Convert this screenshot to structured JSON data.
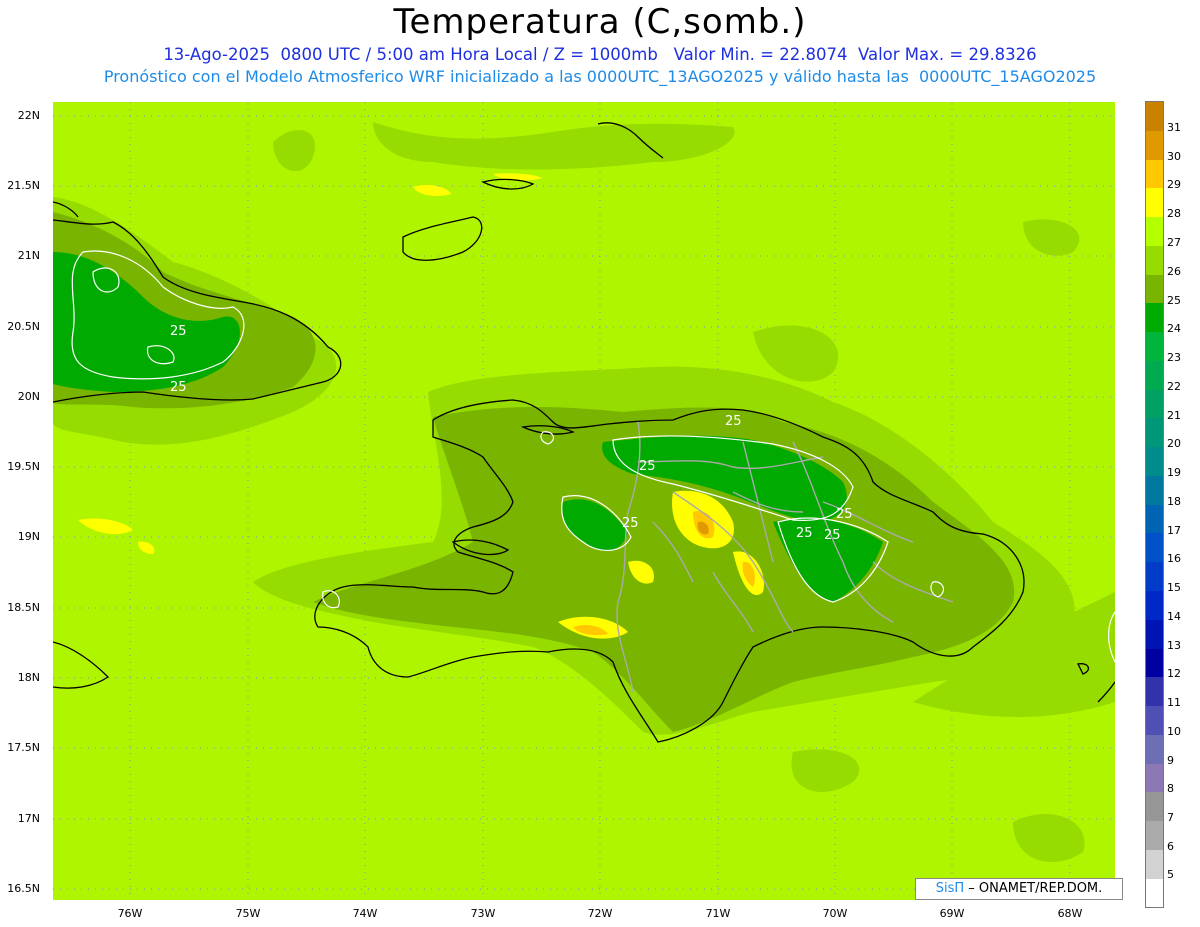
{
  "header": {
    "title": "Temperatura (C,somb.)",
    "line1": "13-Ago-2025  0800 UTC / 5:00 am Hora Local / Z = 1000mb   Valor Min. = 22.8074  Valor Max. = 29.8326",
    "line2": "Pronóstico con el Modelo Atmosferico WRF inicializado a las 0000UTC_13AGO2025 y válido hasta las  0000UTC_15AGO2025"
  },
  "axes": {
    "lat_labels": [
      "22N",
      "21.5N",
      "21N",
      "20.5N",
      "20N",
      "19.5N",
      "19N",
      "18.5N",
      "18N",
      "17.5N",
      "17N",
      "16.5N"
    ],
    "lon_labels": [
      "76W",
      "75W",
      "74W",
      "73W",
      "72W",
      "71W",
      "70W",
      "69W",
      "68W"
    ]
  },
  "contour_labels": [
    "25",
    "25",
    "25",
    "25",
    "25",
    "25",
    "25",
    "25"
  ],
  "colorbar": {
    "labels": [
      "31",
      "30",
      "29",
      "28",
      "27",
      "26",
      "25",
      "24",
      "23",
      "22",
      "21",
      "20",
      "19",
      "18",
      "17",
      "16",
      "15",
      "14",
      "13",
      "12",
      "11",
      "10",
      "9",
      "8",
      "7",
      "6",
      "5"
    ],
    "colors": [
      "#c88200",
      "#e09900",
      "#ffc800",
      "#ffff00",
      "#b4ff00",
      "#96dc00",
      "#78b400",
      "#00aa00",
      "#00b43c",
      "#00aa50",
      "#00a064",
      "#009678",
      "#008c8c",
      "#0078a0",
      "#0064b4",
      "#0050c8",
      "#003cc8",
      "#0028c8",
      "#0014b4",
      "#0000a0",
      "#3232aa",
      "#5050b4",
      "#6e6eb4",
      "#8c78b4",
      "#969696",
      "#aaaaaa",
      "#d2d2d2",
      "#ffffff"
    ]
  },
  "credit": {
    "brand": "SisΠ",
    "org": "– ONAMET/REP.DOM."
  }
}
